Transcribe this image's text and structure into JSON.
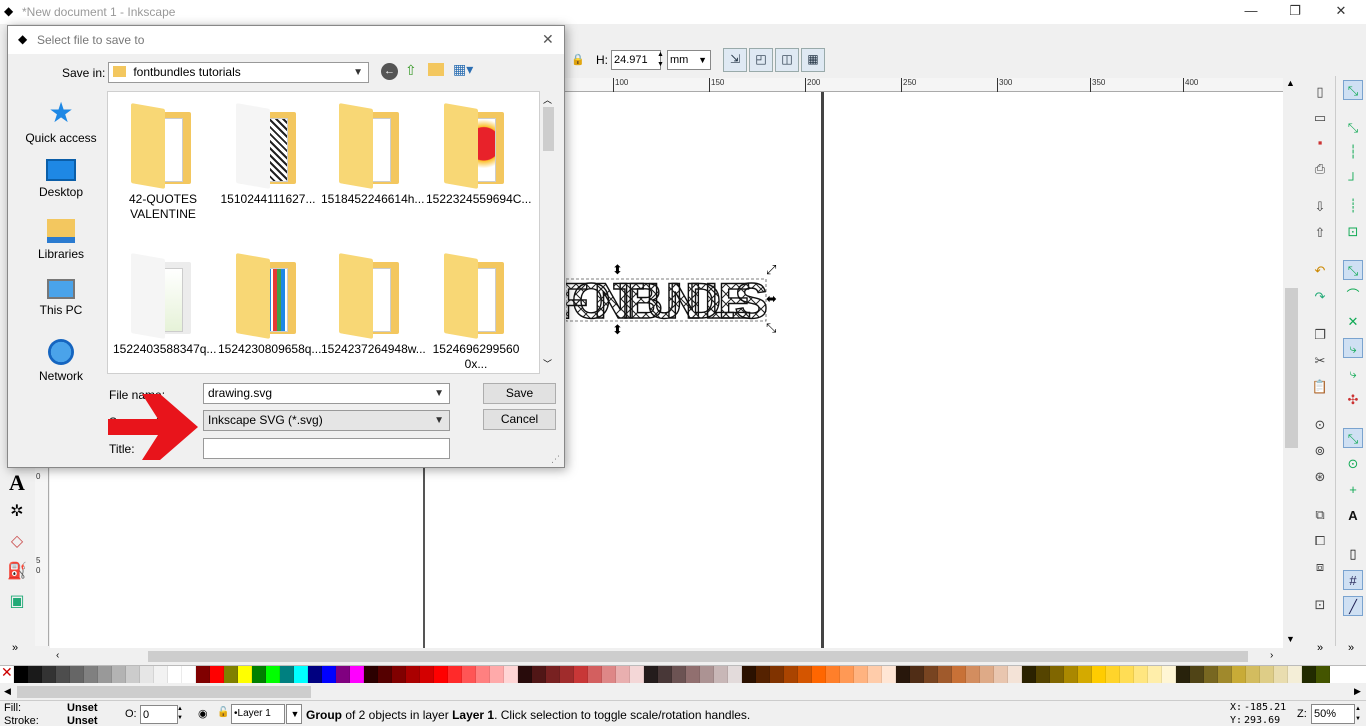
{
  "window": {
    "title": "*New document 1 - Inkscape",
    "minimize": "—",
    "maximize": "❐",
    "close": "✕"
  },
  "toolbar": {
    "h_label": "H:",
    "h_value": "24.971",
    "unit": "mm"
  },
  "ruler": {
    "h_ticks": [
      "100",
      "150",
      "200",
      "250",
      "300",
      "350",
      "400"
    ],
    "v_ticks": [
      "0",
      "5",
      "0"
    ]
  },
  "artwork": {
    "text": "FONTBUNDLES"
  },
  "dialog": {
    "title": "Select file to save to",
    "save_in_label": "Save in:",
    "save_in_value": "fontbundles tutorials",
    "places": [
      {
        "label": "Quick access",
        "icon": "star-icon"
      },
      {
        "label": "Desktop",
        "icon": "desktop-icon"
      },
      {
        "label": "Libraries",
        "icon": "libraries-icon"
      },
      {
        "label": "This PC",
        "icon": "computer-icon"
      },
      {
        "label": "Network",
        "icon": "network-icon"
      }
    ],
    "files": [
      {
        "name": "42-QUOTES VALENTINE"
      },
      {
        "name": "1510244111627..."
      },
      {
        "name": "1518452246614h..."
      },
      {
        "name": "1522324559694C..."
      },
      {
        "name": "1522403588347q..."
      },
      {
        "name": "1524230809658q..."
      },
      {
        "name": "1524237264948w..."
      },
      {
        "name": "1524696299560 0x..."
      }
    ],
    "filename_label": "File name:",
    "filename_value": "drawing.svg",
    "savetype_label": "Save as type:",
    "savetype_value": "Inkscape SVG (*.svg)",
    "title_label": "Title:",
    "title_value": "",
    "save_button": "Save",
    "cancel_button": "Cancel"
  },
  "status": {
    "fill_label": "Fill:",
    "fill_value": "Unset",
    "stroke_label": "Stroke:",
    "stroke_value": "Unset",
    "opacity_label": "O:",
    "opacity_value": "0",
    "layer_value": "•Layer 1",
    "message_prefix": "Group",
    "message_mid": " of 2 objects in layer ",
    "message_layer": "Layer 1",
    "message_suffix": ". Click selection to toggle scale/rotation handles.",
    "x_label": "X:",
    "x_value": "-185.21",
    "y_label": "Y:",
    "y_value": "293.69",
    "zoom_label": "Z:",
    "zoom_value": "50%"
  },
  "colors": {
    "accent": "#3c7fb1",
    "arrow_red": "#e8141b",
    "folder": "#f3c75f"
  }
}
